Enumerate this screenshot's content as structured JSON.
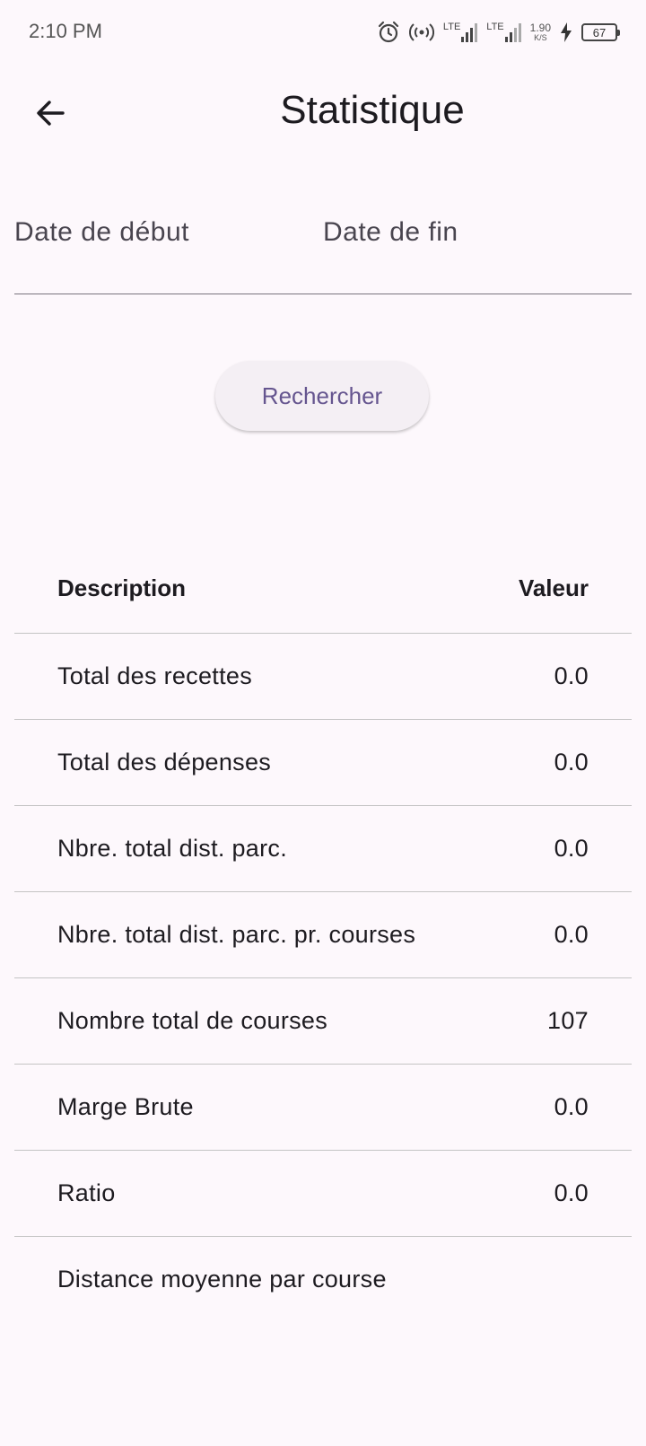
{
  "status_bar": {
    "time": "2:10 PM",
    "lte1": "LTE",
    "lte2": "LTE",
    "net_speed": "1.90",
    "net_unit": "K/S",
    "battery": "67"
  },
  "app_bar": {
    "title": "Statistique"
  },
  "filters": {
    "start_date_label": "Date de début",
    "end_date_label": "Date de fin"
  },
  "search_button_label": "Rechercher",
  "table": {
    "headers": [
      "Description",
      "Valeur"
    ],
    "rows": [
      {
        "description": "Total des recettes",
        "value": "0.0"
      },
      {
        "description": "Total des dépenses",
        "value": "0.0"
      },
      {
        "description": "Nbre. total dist. parc.",
        "value": "0.0"
      },
      {
        "description": "Nbre. total dist. parc. pr. courses",
        "value": "0.0"
      },
      {
        "description": "Nombre total de courses",
        "value": "107"
      },
      {
        "description": "Marge Brute",
        "value": "0.0"
      },
      {
        "description": "Ratio",
        "value": "0.0"
      },
      {
        "description": "Distance moyenne par course",
        "value": ""
      }
    ]
  },
  "colors": {
    "background": "#fdf8fc",
    "accent": "#65558f",
    "button_bg": "#f4eff4",
    "divider": "#c4c4c4"
  }
}
